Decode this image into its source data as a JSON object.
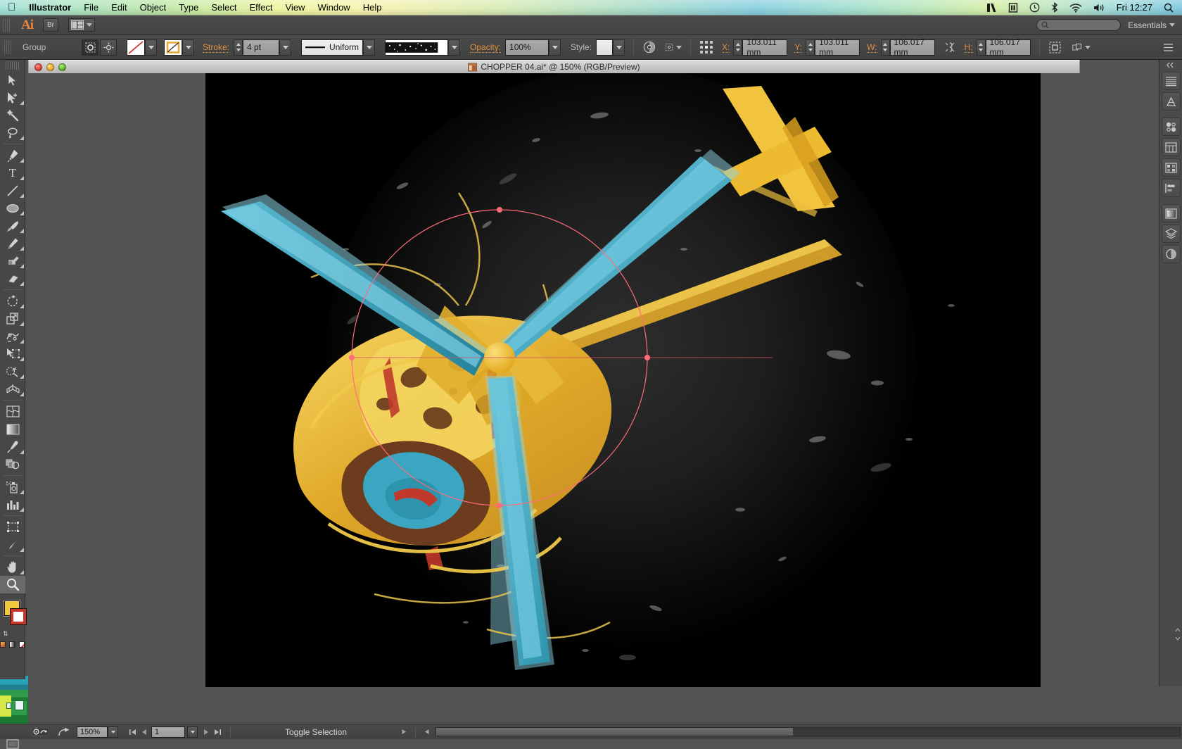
{
  "menubar": {
    "apple": "",
    "app_name": "Illustrator",
    "menus": [
      "File",
      "Edit",
      "Object",
      "Type",
      "Select",
      "Effect",
      "View",
      "Window",
      "Help"
    ],
    "status_icons": [
      "adobe-cc-icon",
      "time-machine-icon",
      "clock-icon",
      "bluetooth-icon",
      "wifi-icon",
      "volume-icon"
    ],
    "clock": "Fri 12:27",
    "spotlight": "search-icon"
  },
  "appbar": {
    "logo": "Ai",
    "bridge_label": "Br",
    "arrange_docs": "arrange-documents-icon",
    "workspace": "Essentials",
    "search_placeholder": ""
  },
  "control_panel": {
    "selection_label": "Group",
    "stroke_label": "Stroke:",
    "stroke_value": "4 pt",
    "profile_label": "Uniform",
    "opacity_label": "Opacity:",
    "opacity_value": "100%",
    "style_label": "Style:",
    "x_label": "X:",
    "x_value": "103.011 mm",
    "y_label": "Y:",
    "y_value": "103.011 mm",
    "w_label": "W:",
    "w_value": "106.017 mm",
    "h_label": "H:",
    "h_value": "106.017 mm",
    "icons": [
      "isolate-group-icon",
      "target-icon",
      "fill-swatch-icon",
      "stroke-swatch-icon",
      "brush-definition-icon",
      "opacity-mask-icon",
      "recolor-artwork-icon",
      "align-reference-icon",
      "constrain-proportions-icon",
      "transform-icon",
      "arrange-icon",
      "panel-menu-icon"
    ]
  },
  "document": {
    "title": "CHOPPER 04.ai* @ 150% (RGB/Preview)",
    "file_icon": "ai-document-icon",
    "window_buttons": [
      "close",
      "minimize",
      "zoom"
    ]
  },
  "tools": {
    "items": [
      {
        "name": "selection-tool",
        "glyph": "arrow"
      },
      {
        "name": "direct-selection-tool",
        "glyph": "arrow-plus"
      },
      {
        "name": "magic-wand-tool",
        "glyph": "wand"
      },
      {
        "name": "lasso-tool",
        "glyph": "lasso"
      },
      {
        "name": "pen-tool",
        "glyph": "pen"
      },
      {
        "name": "type-tool",
        "glyph": "T"
      },
      {
        "name": "line-segment-tool",
        "glyph": "line"
      },
      {
        "name": "ellipse-tool",
        "glyph": "ellipse"
      },
      {
        "name": "paintbrush-tool",
        "glyph": "brush"
      },
      {
        "name": "pencil-tool",
        "glyph": "pencil"
      },
      {
        "name": "blob-brush-tool",
        "glyph": "blob"
      },
      {
        "name": "eraser-tool",
        "glyph": "eraser"
      },
      {
        "name": "rotate-tool",
        "glyph": "rotate"
      },
      {
        "name": "scale-tool",
        "glyph": "scale"
      },
      {
        "name": "width-tool",
        "glyph": "warp"
      },
      {
        "name": "free-transform-tool",
        "glyph": "free-transform"
      },
      {
        "name": "shape-builder-tool",
        "glyph": "shape-builder"
      },
      {
        "name": "perspective-grid-tool",
        "glyph": "perspective"
      },
      {
        "name": "mesh-tool",
        "glyph": "mesh"
      },
      {
        "name": "gradient-tool",
        "glyph": "gradient"
      },
      {
        "name": "eyedropper-tool",
        "glyph": "eyedropper"
      },
      {
        "name": "blend-tool",
        "glyph": "blend"
      },
      {
        "name": "symbol-sprayer-tool",
        "glyph": "sprayer"
      },
      {
        "name": "column-graph-tool",
        "glyph": "graph"
      },
      {
        "name": "artboard-tool",
        "glyph": "artboard"
      },
      {
        "name": "slice-tool",
        "glyph": "slice"
      },
      {
        "name": "hand-tool",
        "glyph": "hand"
      },
      {
        "name": "zoom-tool",
        "glyph": "magnifier",
        "selected": true
      }
    ],
    "fill_color": "#f0c93f",
    "stroke_color": "#c9352c"
  },
  "dock": {
    "panels": [
      "color-panel-icon",
      "color-guide-icon",
      "brushes-panel-icon",
      "symbols-panel-icon",
      "swatches-panel-icon",
      "align-panel-icon",
      "transparency-panel-icon",
      "gradient-panel-icon",
      "layers-panel-icon",
      "appearance-panel-icon"
    ]
  },
  "statusbar": {
    "zoom_value": "150%",
    "page_value": "1",
    "status_text": "Toggle Selection",
    "nav_first": "first-page-icon",
    "nav_prev": "previous-page-icon",
    "nav_next": "next-page-icon",
    "nav_last": "last-page-icon",
    "preflight_icon": "preflight-icon",
    "share_icon": "share-my-screen-icon"
  },
  "artwork": {
    "description": "helicopter-illustration",
    "colors": {
      "background": "#000000",
      "body_yellow": "#e8b62c",
      "body_yellow_light": "#f4d35e",
      "rotor_blue": "#3ba8c4",
      "rotor_blue_light": "#63c4d8",
      "brown": "#6b3a1e",
      "red": "#c0392b",
      "hub": "#f0b429",
      "selection_pink": "#ff6b7a"
    }
  }
}
